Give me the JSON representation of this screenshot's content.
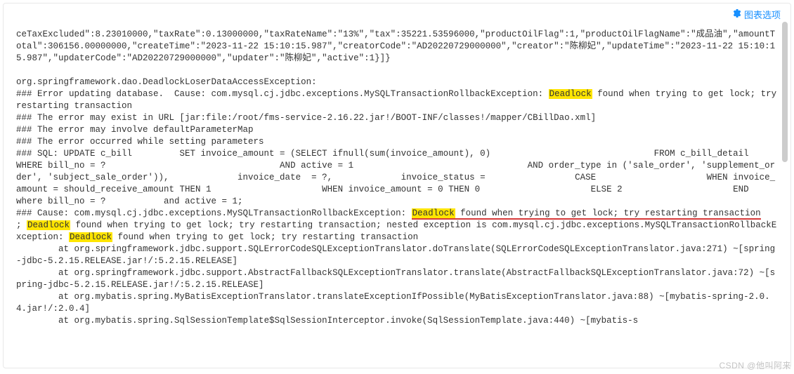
{
  "toolbar": {
    "chart_options_label": "图表选项"
  },
  "log": {
    "l1": "ceTaxExcluded\":8.23010000,\"taxRate\":0.13000000,\"taxRateName\":\"13%\",\"tax\":35221.53596000,\"productOilFlag\":1,\"productOilFlagName\":\"成品油\",\"amountTotal\":306156.00000000,\"createTime\":\"2023-11-22 15:10:15.987\",\"creatorCode\":\"AD20220729000000\",\"creator\":\"陈柳妃\",\"updateTime\":\"2023-11-22 15:10:15.987\",\"updaterCode\":\"AD20220729000000\",\"updater\":\"陈柳妃\",\"active\":1}]}",
    "l3": "org.springframework.dao.DeadlockLoserDataAccessException:",
    "l4a": "### Error updating database.  Cause: com.mysql.cj.jdbc.exceptions.MySQLTransactionRollbackException: ",
    "l4_hl": "Deadlock",
    "l4b": " found when trying to get lock; try restarting transaction",
    "l5": "### The error may exist in URL [jar:file:/root/fms-service-2.16.22.jar!/BOOT-INF/classes!/mapper/CBillDao.xml]",
    "l6": "### The error may involve defaultParameterMap",
    "l7": "### The error occurred while setting parameters",
    "l8": "### SQL: UPDATE c_bill         SET invoice_amount = (SELECT ifnull(sum(invoice_amount), 0)                               FROM c_bill_detail                               WHERE bill_no = ?                                 AND active = 1                                 AND order_type in ('sale_order', 'supplement_order', 'subject_sale_order')),             invoice_date  = ?,             invoice_status =                 CASE                     WHEN invoice_amount = should_receive_amount THEN 1                     WHEN invoice_amount = 0 THEN 0                     ELSE 2                     END         where bill_no = ?           and active = 1;",
    "l9a": "### Cause: com.mysql.cj.jdbc.exceptions.MySQLTransactionRollbackException: ",
    "l9_hl": "Deadlock",
    "l9b": " found when trying to get lock; try restarting transaction",
    "l10a": "; ",
    "l10_hl": "Deadlock",
    "l10b": " found when trying to get lock; try restarting transaction; nested exception is com.mysql.cj.jdbc.exceptions.MySQLTransactionRollbackException: ",
    "l10_hl2": "Deadlock",
    "l10c": " found when trying to get lock; try restarting transaction",
    "l11": "        at org.springframework.jdbc.support.SQLErrorCodeSQLExceptionTranslator.doTranslate(SQLErrorCodeSQLExceptionTranslator.java:271) ~[spring-jdbc-5.2.15.RELEASE.jar!/:5.2.15.RELEASE]",
    "l12": "        at org.springframework.jdbc.support.AbstractFallbackSQLExceptionTranslator.translate(AbstractFallbackSQLExceptionTranslator.java:72) ~[spring-jdbc-5.2.15.RELEASE.jar!/:5.2.15.RELEASE]",
    "l13": "        at org.mybatis.spring.MyBatisExceptionTranslator.translateExceptionIfPossible(MyBatisExceptionTranslator.java:88) ~[mybatis-spring-2.0.4.jar!/:2.0.4]",
    "l14": "        at org.mybatis.spring.SqlSessionTemplate$SqlSessionInterceptor.invoke(SqlSessionTemplate.java:440) ~[mybatis-s"
  },
  "watermark": "CSDN @他叫阿来"
}
